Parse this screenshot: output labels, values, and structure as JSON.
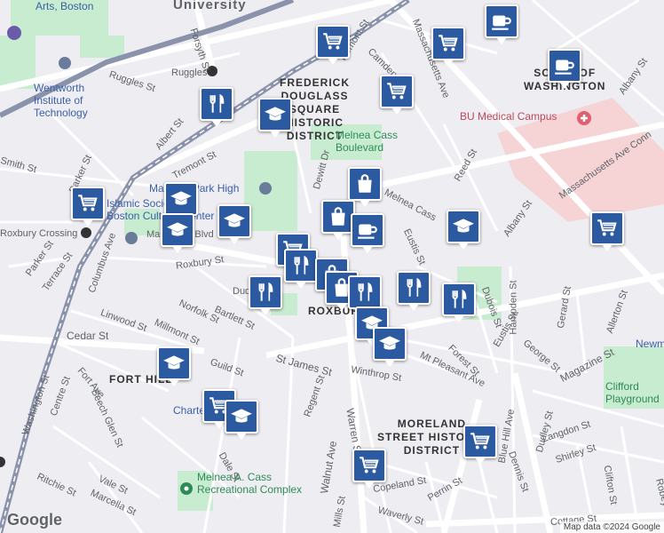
{
  "labels": {
    "arts_boston": "Arts, Boston",
    "university": "University",
    "wentworth": "Wentworth\nInstitute of\nTechnology",
    "ruggles": "Ruggles",
    "ruggles_st": "Ruggles St",
    "forsyth_st": "Forsyth St",
    "frederick": "FREDERICK\nDOUGLASS\nSQUARE\nHISTORIC\nDISTRICT",
    "tremont_st": "Tremont St",
    "tremont_st2": "Tremont St",
    "massachusetts_ave": "Massachusetts Ave",
    "camden_st": "Camden St",
    "south_washington": "SOUTH OF\nWASHINGTON",
    "albany_st": "Albany St",
    "albany_st2": "Albany St",
    "bu_medical": "BU Medical Campus",
    "mass_ave_conn": "Massachusetts Ave Conn",
    "melnea_cass_blvd": "Melnea Cass\nBoulevard",
    "melnea_cass": "Melnea Cass",
    "reed_st": "Reed St",
    "dewitt_dr": "Dewitt Dr",
    "parker_st": "Parker St",
    "smith_st": "Smith St",
    "albert_st": "Albert St",
    "park_high": "Madison Park High",
    "islamic": "Islamic Society of\nBoston Cultural Center",
    "roxbury_crossing": "Roxbury Crossing",
    "malcolm_x": "Malcolm X Blvd",
    "roxbury_st": "Roxbury St",
    "columbus_ave": "Columbus Ave",
    "terrace_st": "Terrace St",
    "parker_st2": "Parker St",
    "dudley": "Dudley St",
    "norfolk_st": "Norfolk St",
    "bartlett_st": "Bartlett St",
    "linwood_st": "Linwood St",
    "millmont_st": "Millmont St",
    "cedar_st": "Cedar St",
    "guild_st": "Guild St",
    "st_james_st": "St James St",
    "fort_hill": "FORT HILL",
    "fort_ave": "Fort Ave",
    "centre_st": "Centre St",
    "beech_glen": "Beech Glen St",
    "charter": "Charter Hill",
    "regent_st": "Regent St",
    "roxbury": "ROXBURY",
    "eustis_st": "Eustis St",
    "eustis_st2": "Eustis St",
    "dubois_st": "Dubois St",
    "hampden_st": "Hampden St",
    "gerard_st": "Gerard St",
    "allerton_st": "Allerton St",
    "george_st": "George St",
    "magazine_st": "Magazine St",
    "clifford": "Clifford\nPlayground",
    "newmarket": "Newmarket",
    "winthrop_st": "Winthrop St",
    "mt_pleasant": "Mt Pleasant Ave",
    "forest_st": "Forest St",
    "moreland": "MORELAND\nSTREET HISTORIC\nDISTRICT",
    "dudley_st": "Dudley St",
    "langdon_st": "Langdon St",
    "shirley_st": "Shirley St",
    "dennis_st": "Dennis St",
    "clifton_st": "Clifton St",
    "walnut_ave": "Walnut Ave",
    "warren_st": "Warren St",
    "dale_st": "Dale St",
    "melnea_complex": "Melnea A. Cass\nRecreational Complex",
    "ritchie_st": "Ritchie St",
    "vale_st": "Vale St",
    "marcella_st": "Marcella St",
    "copeland_st": "Copeland St",
    "perrin_st": "Perrin St",
    "mills_st": "Mills St",
    "waverly_st": "Waverly St",
    "cottage_st": "Cottage St",
    "robey_st": "Robey St",
    "blue_hill_ave": "Blue Hill Ave",
    "washington_st": "Washington St"
  },
  "markers": [
    {
      "name": "grocery",
      "icon": "cart-icon"
    },
    {
      "name": "grocery",
      "icon": "cart-icon"
    },
    {
      "name": "cafe",
      "icon": "cup-icon"
    },
    {
      "name": "cafe",
      "icon": "cup-icon"
    },
    {
      "name": "grocery",
      "icon": "cart-icon"
    },
    {
      "name": "restaurant",
      "icon": "fork-knife-icon"
    },
    {
      "name": "school",
      "icon": "graduation-cap-icon"
    },
    {
      "name": "grocery",
      "icon": "cart-icon"
    },
    {
      "name": "school",
      "icon": "graduation-cap-icon"
    },
    {
      "name": "school",
      "icon": "graduation-cap-icon"
    },
    {
      "name": "school",
      "icon": "graduation-cap-icon"
    },
    {
      "name": "shop",
      "icon": "bag-icon"
    },
    {
      "name": "shop",
      "icon": "bag-icon"
    },
    {
      "name": "cafe",
      "icon": "cup-icon"
    },
    {
      "name": "grocery",
      "icon": "cart-icon"
    },
    {
      "name": "restaurant",
      "icon": "fork-knife-icon"
    },
    {
      "name": "shop",
      "icon": "bag-icon"
    },
    {
      "name": "restaurant",
      "icon": "fork-knife-icon"
    },
    {
      "name": "shop",
      "icon": "bag-icon"
    },
    {
      "name": "restaurant",
      "icon": "fork-knife-icon"
    },
    {
      "name": "restaurant",
      "icon": "fork-knife-icon"
    },
    {
      "name": "restaurant",
      "icon": "fork-knife-icon"
    },
    {
      "name": "school",
      "icon": "graduation-cap-icon"
    },
    {
      "name": "school",
      "icon": "graduation-cap-icon"
    },
    {
      "name": "school",
      "icon": "graduation-cap-icon"
    },
    {
      "name": "grocery",
      "icon": "cart-icon"
    },
    {
      "name": "school",
      "icon": "graduation-cap-icon"
    },
    {
      "name": "grocery",
      "icon": "cart-icon"
    },
    {
      "name": "grocery",
      "icon": "cart-icon"
    },
    {
      "name": "grocery",
      "icon": "cart-icon"
    },
    {
      "name": "school",
      "icon": "graduation-cap-icon"
    }
  ],
  "footer": {
    "google": "Google",
    "attribution": "Map data ©2024 Google"
  },
  "colors": {
    "marker": "#2c5aa0",
    "park": "#c8ecd0",
    "medical": "#f6d4d6",
    "road": "#ffffff",
    "transit": "#7f8da8"
  }
}
